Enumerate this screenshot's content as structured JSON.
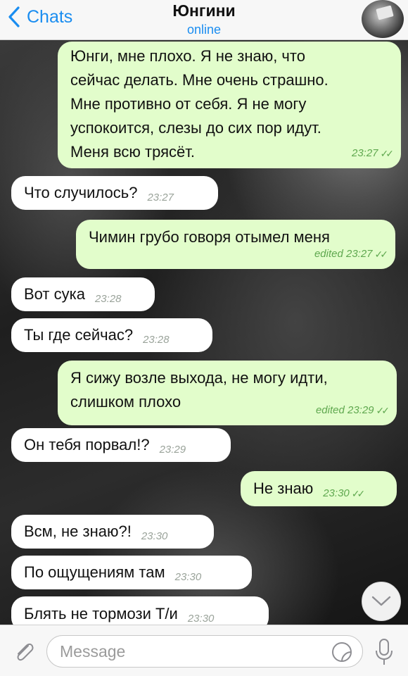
{
  "header": {
    "back_label": "Chats",
    "title": "Юнгини",
    "status": "online"
  },
  "messages": [
    {
      "dir": "out",
      "text": "Юнги, мне плохо. Я не знаю, что\nсейчас делать. Мне очень страшно.\nМне противно от себя. Я не могу\nуспокоится, слезы до сих пор идут.\nМеня всю трясёт.",
      "time": "23:27",
      "checks": "✓✓"
    },
    {
      "dir": "in",
      "text": "Что случилось?",
      "time": "23:27"
    },
    {
      "dir": "out",
      "text": "Чимин грубо говоря отымел меня",
      "time": "edited 23:27",
      "checks": "✓✓"
    },
    {
      "dir": "in",
      "text": "Вот сука",
      "time": "23:28"
    },
    {
      "dir": "in",
      "text": "Ты где сейчас?",
      "time": "23:28"
    },
    {
      "dir": "out",
      "text": "Я сижу возле выхода, не могу идти,\nслишком плохо",
      "time": "edited 23:29",
      "checks": "✓✓"
    },
    {
      "dir": "in",
      "text": "Он тебя порвал!?",
      "time": "23:29"
    },
    {
      "dir": "out",
      "text": "Не знаю",
      "time": "23:30",
      "checks": "✓✓"
    },
    {
      "dir": "in",
      "text": "Всм, не знаю?!",
      "time": "23:30"
    },
    {
      "dir": "in",
      "text": "По ощущениям там",
      "time": "23:30"
    },
    {
      "dir": "in",
      "text": "Блять не тормози Т/и",
      "time": "23:30"
    }
  ],
  "input": {
    "placeholder": "Message"
  },
  "icons": {
    "back": "chevron-left-icon",
    "attach": "paperclip-icon",
    "sticker": "sticker-icon",
    "mic": "microphone-icon",
    "scroll": "chevron-down-icon"
  },
  "colors": {
    "accent": "#1a8df0",
    "outgoing_bubble": "#e2fdcb",
    "incoming_bubble": "#ffffff",
    "outgoing_meta": "#5fa84f"
  }
}
